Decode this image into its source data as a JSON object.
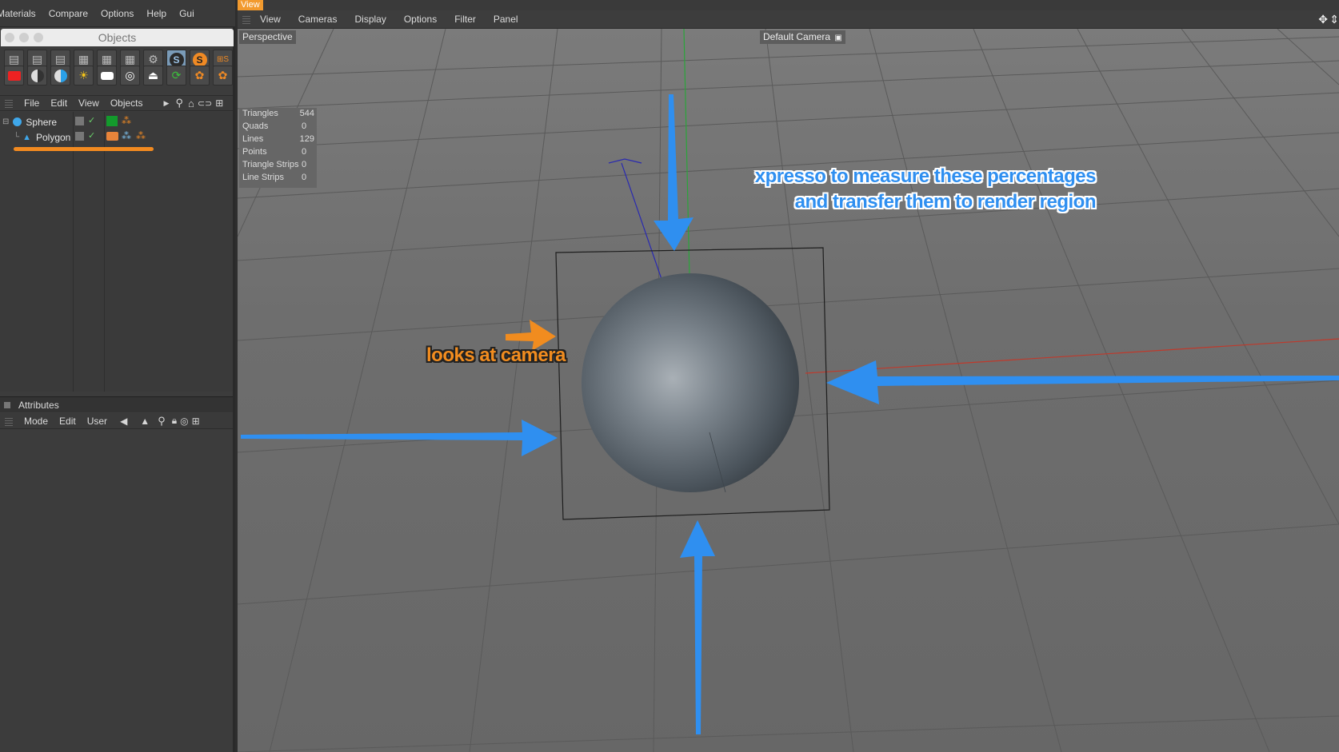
{
  "top_menu": [
    "Materials",
    "Compare",
    "Options",
    "Help",
    "Gui"
  ],
  "objects_panel": {
    "title": "Objects",
    "menu": [
      "File",
      "Edit",
      "View",
      "Objects"
    ],
    "objects": [
      {
        "name": "Sphere",
        "icon": "sphere-icon"
      },
      {
        "name": "Polygon",
        "icon": "polygon-icon"
      }
    ]
  },
  "attributes_panel": {
    "title": "Attributes",
    "menu": [
      "Mode",
      "Edit",
      "User"
    ]
  },
  "viewport": {
    "tab": "View",
    "menu": [
      "View",
      "Cameras",
      "Display",
      "Options",
      "Filter",
      "Panel"
    ],
    "projection": "Perspective",
    "camera": "Default Camera",
    "stats": [
      {
        "label": "Triangles",
        "value": "544"
      },
      {
        "label": "Quads",
        "value": "0"
      },
      {
        "label": "Lines",
        "value": "129"
      },
      {
        "label": "Points",
        "value": "0"
      },
      {
        "label": "Triangle Strips",
        "value": "0"
      },
      {
        "label": "Line Strips",
        "value": "0"
      }
    ]
  },
  "annotations": {
    "blue_line1": "xpresso to measure these percentages",
    "blue_line2": "and transfer them to render region",
    "orange": "looks at camera"
  },
  "colors": {
    "accent": "#f29a2e",
    "arrow_blue": "#2f8ff0",
    "arrow_orange": "#f18c1f"
  }
}
